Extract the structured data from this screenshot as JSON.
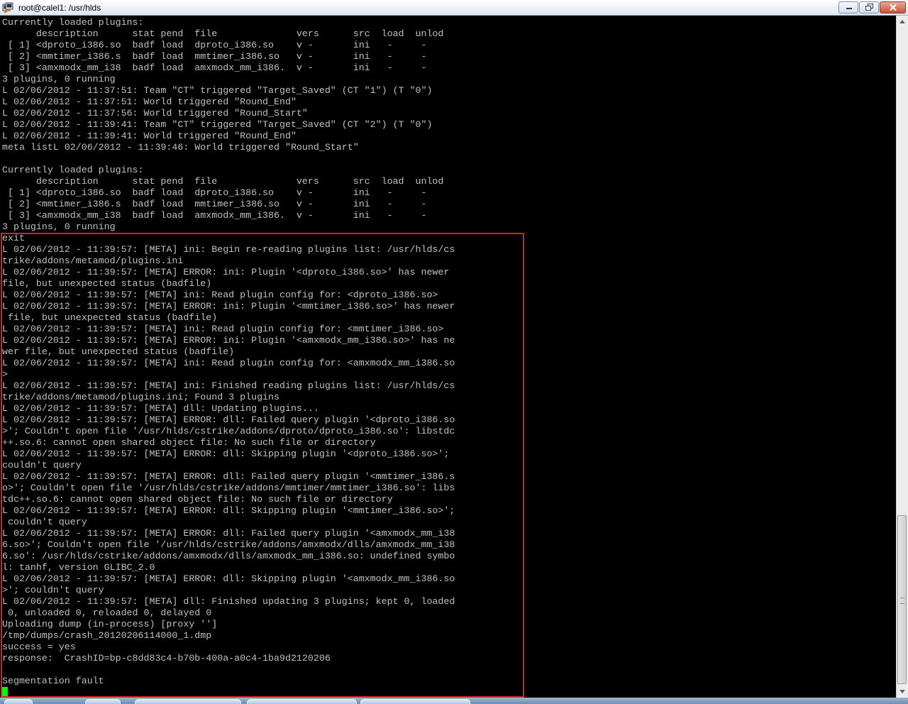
{
  "window": {
    "title": "root@calel1: /usr/hlds",
    "icon": "putty-terminal-icon",
    "controls": [
      "minimize-icon",
      "maximize-icon",
      "close-icon"
    ]
  },
  "terminal": {
    "foreground": "#c0c0c0",
    "background": "#000000",
    "cursor_color": "#00ff00",
    "highlight_color": "#e02020",
    "lines": [
      "Currently loaded plugins:",
      "      description      stat pend  file              vers      src  load  unlod",
      " [ 1] <dproto_i386.so  badf load  dproto_i386.so    v -       ini   -     -",
      " [ 2] <mmtimer_i386.s  badf load  mmtimer_i386.so   v -       ini   -     -",
      " [ 3] <amxmodx_mm_i38  badf load  amxmodx_mm_i386.  v -       ini   -     -",
      "3 plugins, 0 running",
      "L 02/06/2012 - 11:37:51: Team \"CT\" triggered \"Target_Saved\" (CT \"1\") (T \"0\")",
      "L 02/06/2012 - 11:37:51: World triggered \"Round_End\"",
      "L 02/06/2012 - 11:37:56: World triggered \"Round_Start\"",
      "L 02/06/2012 - 11:39:41: Team \"CT\" triggered \"Target_Saved\" (CT \"2\") (T \"0\")",
      "L 02/06/2012 - 11:39:41: World triggered \"Round_End\"",
      "meta listL 02/06/2012 - 11:39:46: World triggered \"Round_Start\"",
      "",
      "Currently loaded plugins:",
      "      description      stat pend  file              vers      src  load  unlod",
      " [ 1] <dproto_i386.so  badf load  dproto_i386.so    v -       ini   -     -",
      " [ 2] <mmtimer_i386.s  badf load  mmtimer_i386.so   v -       ini   -     -",
      " [ 3] <amxmodx_mm_i38  badf load  amxmodx_mm_i386.  v -       ini   -     -",
      "3 plugins, 0 running",
      "exit",
      "L 02/06/2012 - 11:39:57: [META] ini: Begin re-reading plugins list: /usr/hlds/cs",
      "trike/addons/metamod/plugins.ini",
      "L 02/06/2012 - 11:39:57: [META] ERROR: ini: Plugin '<dproto_i386.so>' has newer",
      "file, but unexpected status (badfile)",
      "L 02/06/2012 - 11:39:57: [META] ini: Read plugin config for: <dproto_i386.so>",
      "L 02/06/2012 - 11:39:57: [META] ERROR: ini: Plugin '<mmtimer_i386.so>' has newer",
      " file, but unexpected status (badfile)",
      "L 02/06/2012 - 11:39:57: [META] ini: Read plugin config for: <mmtimer_i386.so>",
      "L 02/06/2012 - 11:39:57: [META] ERROR: ini: Plugin '<amxmodx_mm_i386.so>' has ne",
      "wer file, but unexpected status (badfile)",
      "L 02/06/2012 - 11:39:57: [META] ini: Read plugin config for: <amxmodx_mm_i386.so",
      ">",
      "L 02/06/2012 - 11:39:57: [META] ini: Finished reading plugins list: /usr/hlds/cs",
      "trike/addons/metamod/plugins.ini; Found 3 plugins",
      "L 02/06/2012 - 11:39:57: [META] dll: Updating plugins...",
      "L 02/06/2012 - 11:39:57: [META] ERROR: dll: Failed query plugin '<dproto_i386.so",
      ">'; Couldn't open file '/usr/hlds/cstrike/addons/dproto/dproto_i386.so': libstdc",
      "++.so.6: cannot open shared object file: No such file or directory",
      "L 02/06/2012 - 11:39:57: [META] ERROR: dll: Skipping plugin '<dproto_i386.so>';",
      "couldn't query",
      "L 02/06/2012 - 11:39:57: [META] ERROR: dll: Failed query plugin '<mmtimer_i386.s",
      "o>'; Couldn't open file '/usr/hlds/cstrike/addons/mmtimer/mmtimer_i386.so': libs",
      "tdc++.so.6: cannot open shared object file: No such file or directory",
      "L 02/06/2012 - 11:39:57: [META] ERROR: dll: Skipping plugin '<mmtimer_i386.so>';",
      " couldn't query",
      "L 02/06/2012 - 11:39:57: [META] ERROR: dll: Failed query plugin '<amxmodx_mm_i38",
      "6.so>'; Couldn't open file '/usr/hlds/cstrike/addons/amxmodx/dlls/amxmodx_mm_i38",
      "6.so': /usr/hlds/cstrike/addons/amxmodx/dlls/amxmodx_mm_i386.so: undefined symbo",
      "l: tanhf, version GLIBC_2.0",
      "L 02/06/2012 - 11:39:57: [META] ERROR: dll: Skipping plugin '<amxmodx_mm_i386.so",
      ">'; couldn't query",
      "L 02/06/2012 - 11:39:57: [META] dll: Finished updating 3 plugins; kept 0, loaded",
      " 0, unloaded 0, reloaded 0, delayed 0",
      "Uploading dump (in-process) [proxy '']",
      "/tmp/dumps/crash_20120206114000_1.dmp",
      "success = yes",
      "response:  CrashID=bp-c8dd83c4-b70b-400a-a0c4-1ba9d2120206",
      "",
      "Segmentation fault"
    ]
  },
  "scrollbar": {
    "icons": [
      "scroll-up-arrow-icon",
      "scroll-down-arrow-icon"
    ],
    "position_fraction": 0.76
  }
}
